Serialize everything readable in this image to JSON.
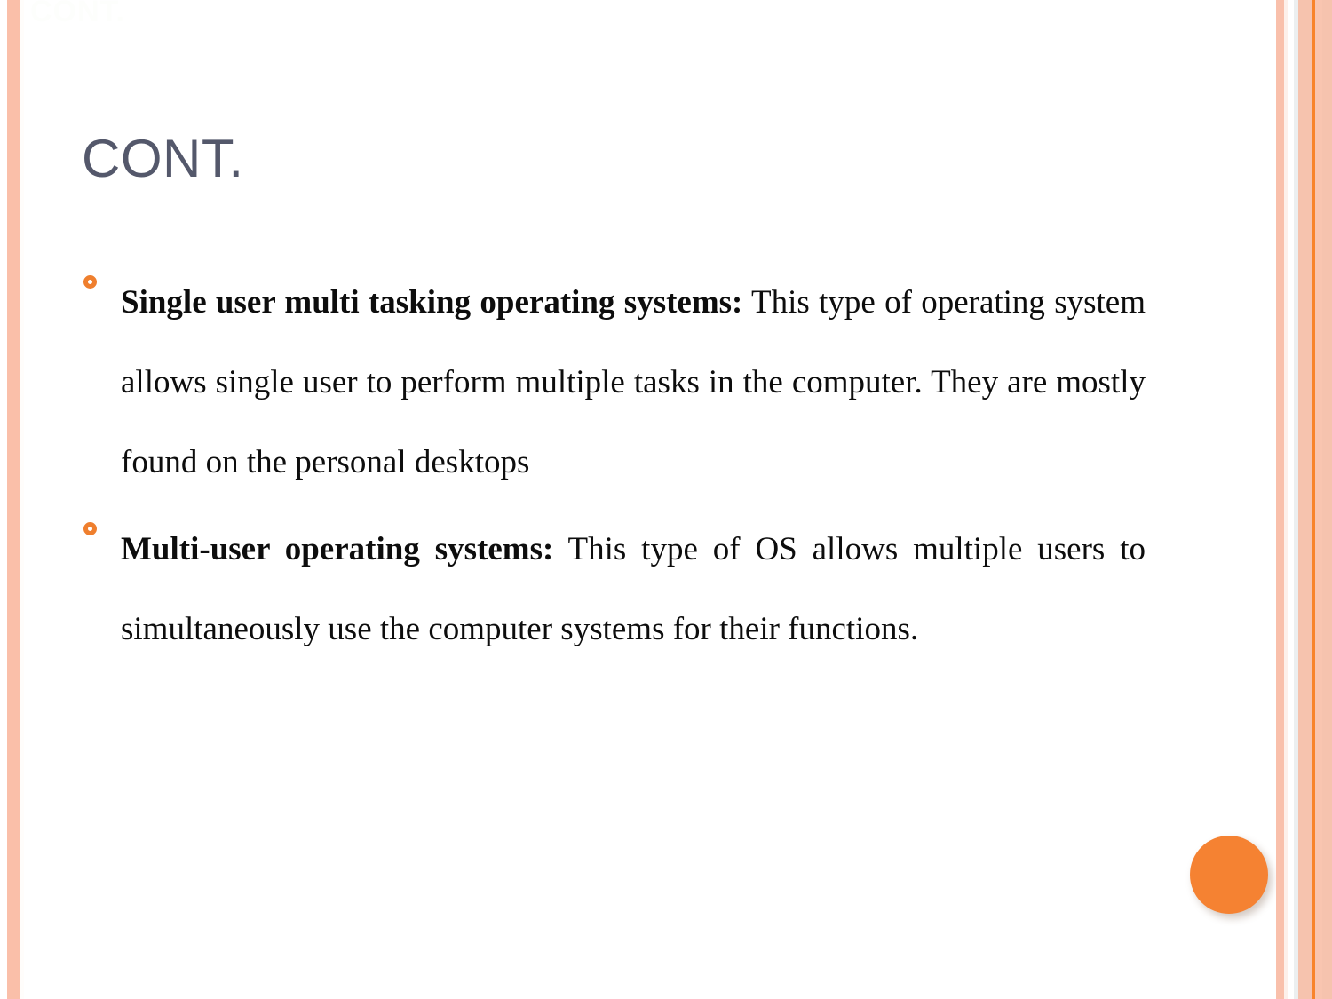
{
  "slide": {
    "title": "CONT.",
    "watermark": "CONT.",
    "background_color": "#ffffff",
    "title_color": "#54586b",
    "accent_color": "#ef7f2e",
    "stripe_color": "#f6c3ae",
    "dot_color": "#f58232",
    "bullets": [
      {
        "marker": "ring-bullet-icon",
        "lead": "Single user multi tasking operating systems:",
        "rest": " This type of operating system allows single user to perform multiple tasks in the computer. They are mostly found on the personal desktops"
      },
      {
        "marker": "ring-bullet-icon",
        "lead": "Multi-user operating systems:",
        "rest": " This type of OS allows multiple users to simultaneously use the computer systems for their functions."
      }
    ]
  }
}
